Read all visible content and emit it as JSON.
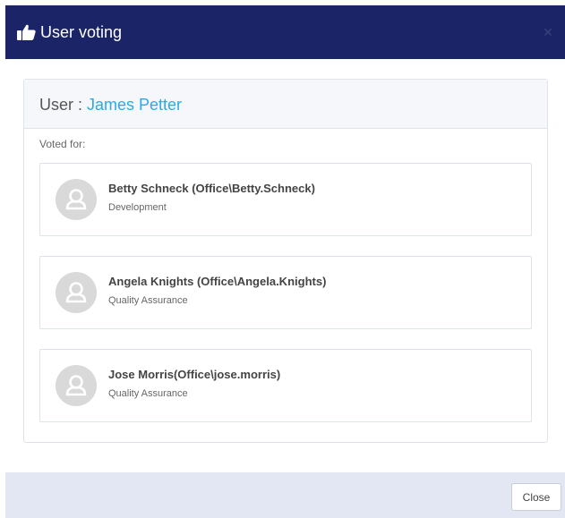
{
  "modal": {
    "title": "User voting",
    "header_color": "#1b2466",
    "close_icon": "close-icon"
  },
  "user": {
    "label": "User : ",
    "name": "James Petter",
    "name_color": "#29abe2"
  },
  "voted_for_label": "Voted for:",
  "votes": [
    {
      "name": "Betty Schneck (Office\\Betty.Schneck)",
      "department": "Development",
      "icon": "user-avatar-icon"
    },
    {
      "name": "Angela Knights (Office\\Angela.Knights)",
      "department": "Quality Assurance",
      "icon": "user-avatar-icon"
    },
    {
      "name": "Jose Morris(Office\\jose.morris)",
      "department": "Quality Assurance",
      "icon": "user-avatar-icon"
    }
  ],
  "footer": {
    "close_label": "Close"
  }
}
